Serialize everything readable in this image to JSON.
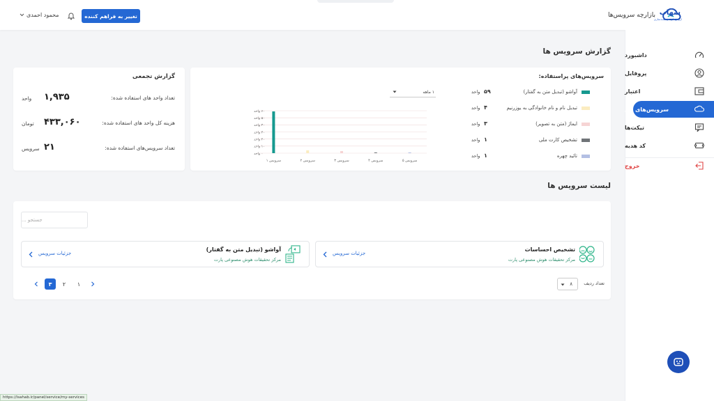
{
  "header": {
    "brand_name": "سهاب",
    "brand_sub": "ارزش‌های هوشمندسازی",
    "marketplace_label": "بازارچه سرویس‌ها",
    "cta_label": "تغییر به فراهم کننده",
    "user_name": "محمود احمدی"
  },
  "sidebar": {
    "items": [
      {
        "label": "داشبورد",
        "icon": "dashboard-gauge-icon"
      },
      {
        "label": "پروفایل",
        "icon": "user-circle-icon"
      },
      {
        "label": "اعتبار",
        "icon": "credit-icon"
      },
      {
        "label": "سرویس‌های من",
        "icon": "cloud-icon",
        "active": true
      },
      {
        "label": "تیکت‌ها",
        "icon": "ticket-icon"
      },
      {
        "label": "کد هدیه",
        "icon": "gift-code-icon"
      },
      {
        "label": "خروج",
        "icon": "logout-icon"
      }
    ]
  },
  "report": {
    "title": "گزارش سرویس ها",
    "summary": {
      "title": "گزارش تجمعی",
      "rows": [
        {
          "label": "تعداد واحد های استفاده شده:",
          "value": "۱,۹۳۵",
          "unit": "واحد"
        },
        {
          "label": "هزینه کل واحد های استفاده شده:",
          "value": "۴۳۳,۰۶۰",
          "unit": "تومان"
        },
        {
          "label": "تعداد سرویس‌های استفاده شده:",
          "value": "۲۱",
          "unit": "سرویس"
        }
      ]
    },
    "used_services": {
      "title": "سرویس‌های پراستفاده:",
      "unit": "واحد",
      "period": "۱ ماهه",
      "legend": [
        {
          "name": "آواشو (تبدیل متن به گفتار)",
          "count": "۵۹",
          "color": "#16998f"
        },
        {
          "name": "تبدیل نام و نام خانوادگی به یوزرنیم",
          "count": "۴",
          "color": "#fbecc0"
        },
        {
          "name": "ایماژ (متن به تصویر)",
          "count": "۳",
          "color": "#f6d4d4"
        },
        {
          "name": "تشخیص کارت ملی",
          "count": "۱",
          "color": "#707478"
        },
        {
          "name": "تائید چهره",
          "count": "۱",
          "color": "#b3bfe3"
        }
      ]
    }
  },
  "chart_data": {
    "type": "bar",
    "categories": [
      "سرویس ۱",
      "سرویس ۲",
      "سرویس ۳",
      "سرویس ۴",
      "سرویس ۵"
    ],
    "values": [
      59,
      4,
      3,
      1,
      1
    ],
    "colors": [
      "#16998f",
      "#fbecc0",
      "#f6d4d4",
      "#707478",
      "#b3bfe3"
    ],
    "yticks": [
      "۰ واحد",
      "۱۰ واحد",
      "۲۰ واحد",
      "۳۰ واحد",
      "۴۰ واحد",
      "۵۰ واحد",
      "۶۰ واحد"
    ],
    "ylim": [
      0,
      60
    ],
    "grid": true
  },
  "services_list": {
    "title": "لیست سرویس ها",
    "search_placeholder": "جستجو ...",
    "details_label": "جزئیات سرویس",
    "cards": [
      {
        "name": "تشخیص احساسات",
        "provider": "مرکز تحقیقات هوش مصنوعی پارت"
      },
      {
        "name": "آواشو (تبدیل متن به گفتار)",
        "provider": "مرکز تحقیقات هوش مصنوعی پارت"
      }
    ],
    "pagination": {
      "pages": [
        "۳",
        "۲",
        "۱"
      ],
      "active": "۳"
    },
    "rows_label": "تعداد ردیف",
    "rows_value": "۸"
  },
  "status_url": "https://isahab.ir/panel/service/my-services"
}
